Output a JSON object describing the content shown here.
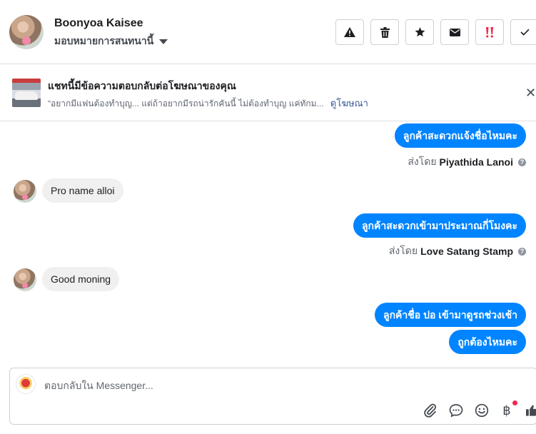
{
  "header": {
    "contact_name": "Boonyoa Kaisee",
    "assign_label": "มอบหมายการสนทนานี้",
    "actions": [
      {
        "name": "warning-button",
        "icon": "warning-icon"
      },
      {
        "name": "delete-button",
        "icon": "trash-icon"
      },
      {
        "name": "star-button",
        "icon": "star-icon"
      },
      {
        "name": "mail-button",
        "icon": "envelope-icon"
      },
      {
        "name": "spam-button",
        "icon": "double-exclamation-icon"
      },
      {
        "name": "done-button",
        "icon": "check-icon"
      }
    ]
  },
  "ad_banner": {
    "title": "แชทนี้มีข้อความตอบกลับต่อโฆษณาของคุณ",
    "snippet": "“อยากมีแฟนต้องทำบุญ... แต่ถ้าอยากมีรถน่ารักคันนี้ ไม่ต้องทำบุญ แค่ทักม...",
    "link": "ดูโฆษณา"
  },
  "messages": [
    {
      "direction": "out",
      "text": "ลูกค้าสะดวกแจ้งชื่อไหมคะ",
      "sent_by_prefix": "ส่งโดย",
      "sent_by_name": "Piyathida Lanoi"
    },
    {
      "direction": "in",
      "text": "Pro name alloi"
    },
    {
      "direction": "out",
      "text": "ลูกค้าสะดวกเข้ามาประมาณกี่โมงคะ",
      "sent_by_prefix": "ส่งโดย",
      "sent_by_name": "Love Satang Stamp"
    },
    {
      "direction": "in",
      "text": "Good moning"
    },
    {
      "direction": "out",
      "text": "ลูกค้าชื่อ ปอ เข้ามาดูรถช่วงเช้า"
    },
    {
      "direction": "out",
      "text": "ถูกต้องไหมคะ"
    }
  ],
  "composer": {
    "placeholder": "ตอบกลับใน Messenger...",
    "baht_symbol": "฿"
  },
  "colors": {
    "accent": "#0084ff",
    "incoming_bubble": "#f1f0f0",
    "spam_red": "#f02849",
    "link": "#385898"
  }
}
